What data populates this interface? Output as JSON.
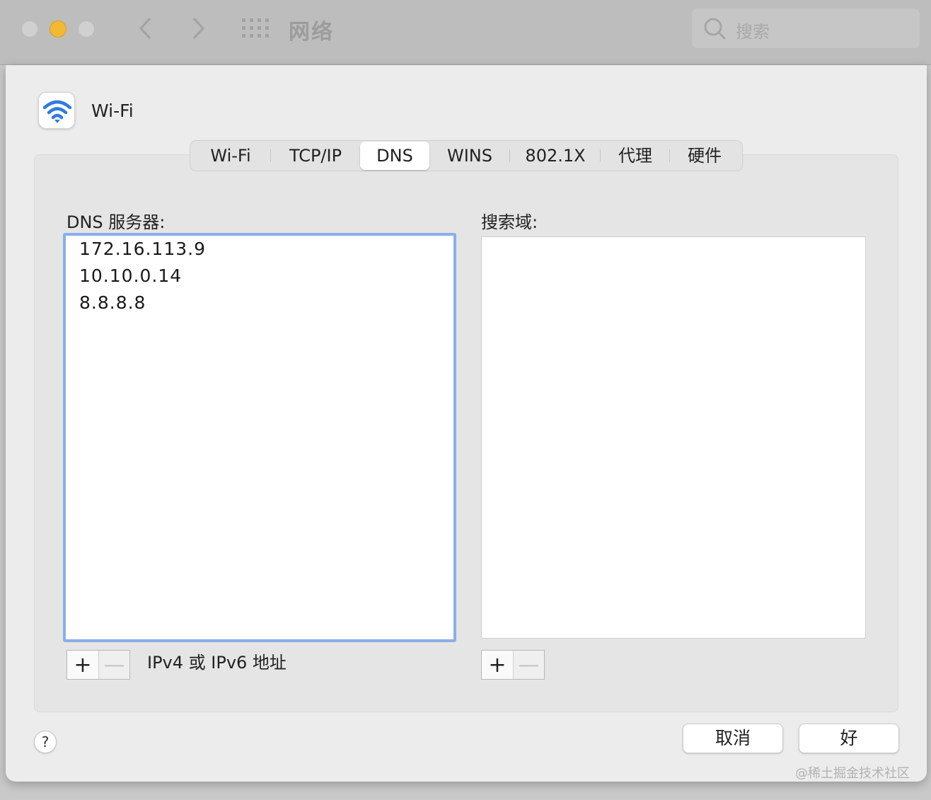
{
  "window": {
    "title": "网络",
    "search_placeholder": "搜索",
    "traffic_lights": [
      "close",
      "minimize",
      "zoom"
    ]
  },
  "service": {
    "name": "Wi-Fi",
    "icon": "wifi-icon"
  },
  "tabs": [
    {
      "label": "Wi-Fi",
      "active": false
    },
    {
      "label": "TCP/IP",
      "active": false
    },
    {
      "label": "DNS",
      "active": true
    },
    {
      "label": "WINS",
      "active": false
    },
    {
      "label": "802.1X",
      "active": false
    },
    {
      "label": "代理",
      "active": false
    },
    {
      "label": "硬件",
      "active": false
    }
  ],
  "dns": {
    "label": "DNS 服务器:",
    "servers": [
      "172.16.113.9",
      "10.10.0.14",
      "8.8.8.8"
    ],
    "hint": "IPv4 或 IPv6 地址"
  },
  "search_domains": {
    "label": "搜索域:",
    "items": []
  },
  "controls": {
    "add": "+",
    "remove": "—",
    "help": "?"
  },
  "buttons": {
    "cancel": "取消",
    "ok": "好"
  },
  "watermark": "@稀土掘金技术社区",
  "colors": {
    "accent_focus": "#8aaee8",
    "wifi_blue": "#2f7be0",
    "minimize_yellow": "#f3b933"
  }
}
